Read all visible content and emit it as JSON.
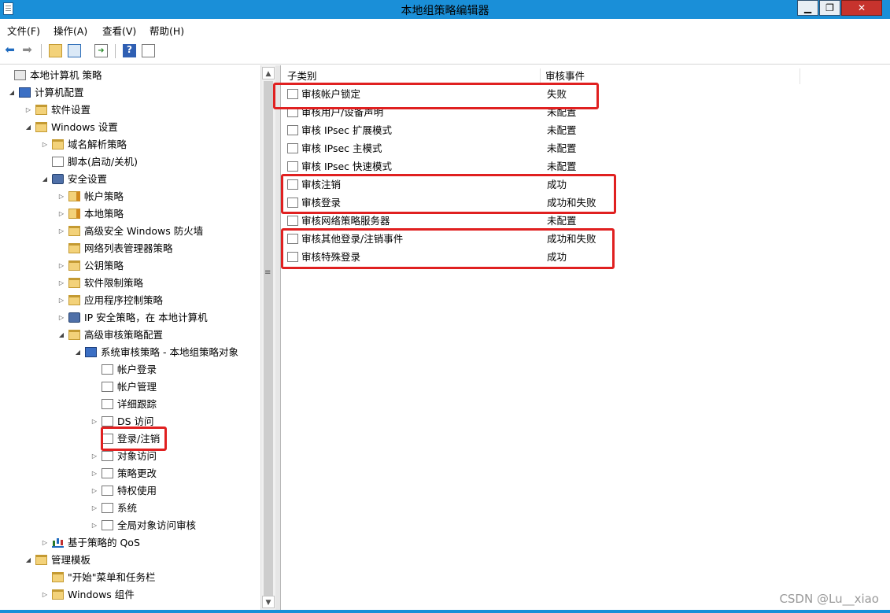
{
  "window": {
    "title": "本地组策略编辑器",
    "min_label": "▁",
    "max_label": "❐",
    "close_label": "✕"
  },
  "menu": [
    "文件(F)",
    "操作(A)",
    "查看(V)",
    "帮助(H)"
  ],
  "tree": [
    {
      "label": "本地计算机 策略",
      "exp": "",
      "icon": "policy-icon"
    },
    {
      "label": "计算机配置",
      "exp": "◢",
      "icon": "computer-icon"
    },
    {
      "label": "软件设置",
      "exp": "▷",
      "icon": "folder-icon"
    },
    {
      "label": "Windows 设置",
      "exp": "◢",
      "icon": "folder-icon"
    },
    {
      "label": "域名解析策略",
      "exp": "▷",
      "icon": "folder-icon"
    },
    {
      "label": "脚本(启动/关机)",
      "exp": "",
      "icon": "script-icon"
    },
    {
      "label": "安全设置",
      "exp": "◢",
      "icon": "security-icon"
    },
    {
      "label": "帐户策略",
      "exp": "▷",
      "icon": "lock-folder-icon"
    },
    {
      "label": "本地策略",
      "exp": "▷",
      "icon": "lock-folder-icon"
    },
    {
      "label": "高级安全 Windows 防火墙",
      "exp": "▷",
      "icon": "folder-icon"
    },
    {
      "label": "网络列表管理器策略",
      "exp": "",
      "icon": "folder-icon"
    },
    {
      "label": "公钥策略",
      "exp": "▷",
      "icon": "folder-icon"
    },
    {
      "label": "软件限制策略",
      "exp": "▷",
      "icon": "folder-icon"
    },
    {
      "label": "应用程序控制策略",
      "exp": "▷",
      "icon": "folder-icon"
    },
    {
      "label": "IP 安全策略，在 本地计算机",
      "exp": "▷",
      "icon": "ip-security-icon"
    },
    {
      "label": "高级审核策略配置",
      "exp": "◢",
      "icon": "folder-icon"
    },
    {
      "label": "系统审核策略 - 本地组策略对象",
      "exp": "◢",
      "icon": "computer-icon"
    },
    {
      "label": "帐户登录",
      "exp": "",
      "icon": "audit-icon"
    },
    {
      "label": "帐户管理",
      "exp": "",
      "icon": "audit-icon"
    },
    {
      "label": "详细跟踪",
      "exp": "",
      "icon": "audit-icon"
    },
    {
      "label": "DS 访问",
      "exp": "▷",
      "icon": "audit-icon"
    },
    {
      "label": "登录/注销",
      "exp": "",
      "icon": "audit-icon"
    },
    {
      "label": "对象访问",
      "exp": "▷",
      "icon": "audit-icon"
    },
    {
      "label": "策略更改",
      "exp": "▷",
      "icon": "audit-icon"
    },
    {
      "label": "特权使用",
      "exp": "▷",
      "icon": "audit-icon"
    },
    {
      "label": "系统",
      "exp": "▷",
      "icon": "audit-icon"
    },
    {
      "label": "全局对象访问审核",
      "exp": "▷",
      "icon": "audit-icon"
    },
    {
      "label": "基于策略的 QoS",
      "exp": "▷",
      "icon": "qos-chart-icon"
    },
    {
      "label": "管理模板",
      "exp": "◢",
      "icon": "folder-icon"
    },
    {
      "label": "\"开始\"菜单和任务栏",
      "exp": "",
      "icon": "folder-icon"
    },
    {
      "label": "Windows 组件",
      "exp": "▷",
      "icon": "folder-icon"
    }
  ],
  "list": {
    "columns": [
      "子类别",
      "审核事件"
    ],
    "rows": [
      {
        "name": "审核帐户锁定",
        "value": "失败"
      },
      {
        "name": "审核用户/设备声明",
        "value": "未配置"
      },
      {
        "name": "审核 IPsec 扩展模式",
        "value": "未配置"
      },
      {
        "name": "审核 IPsec 主模式",
        "value": "未配置"
      },
      {
        "name": "审核 IPsec 快速模式",
        "value": "未配置"
      },
      {
        "name": "审核注销",
        "value": "成功"
      },
      {
        "name": "审核登录",
        "value": "成功和失败"
      },
      {
        "name": "审核网络策略服务器",
        "value": "未配置"
      },
      {
        "name": "审核其他登录/注销事件",
        "value": "成功和失败"
      },
      {
        "name": "审核特殊登录",
        "value": "成功"
      }
    ]
  },
  "watermark": "CSDN @Lu__xiao",
  "colors": {
    "titlebar": "#1a8fd8",
    "highlight_box": "#e02020",
    "close_button": "#c7332d"
  }
}
